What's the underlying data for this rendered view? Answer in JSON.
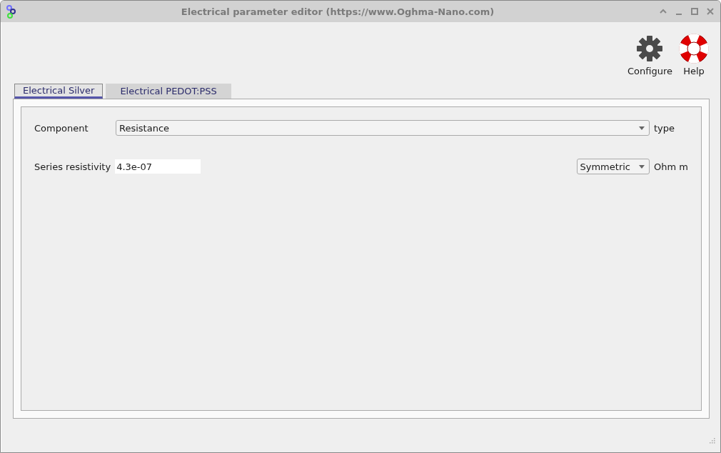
{
  "window": {
    "title": "Electrical parameter editor (https://www.Oghma-Nano.com)"
  },
  "toolbar": [
    {
      "label": "Configure",
      "kind": "gear"
    },
    {
      "label": "Help",
      "kind": "lifebuoy"
    }
  ],
  "tabs": [
    {
      "label": "Electrical Silver",
      "selected": true
    },
    {
      "label": "Electrical PEDOT:PSS",
      "selected": false
    }
  ],
  "rows": [
    {
      "label": "Component",
      "kind": "combo",
      "value": "Resistance",
      "unit": "type"
    },
    {
      "label": "Series resistivity",
      "kind": "entry",
      "value": "4.3e-07",
      "mode": "Symmetric",
      "unit": "Ohm m"
    }
  ]
}
